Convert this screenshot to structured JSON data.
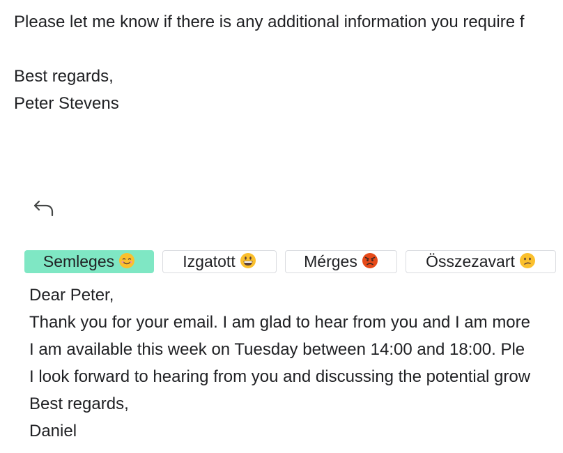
{
  "original_email": {
    "closing_line": "Please let me know if there is any additional information you require f",
    "signoff": "Best regards,",
    "sender_name": "Peter Stevens"
  },
  "reply_icon": "reply-arrow-icon",
  "tone_options": [
    {
      "label": "Semleges",
      "emoji": "smiling-face-icon",
      "selected": true
    },
    {
      "label": "Izgatott",
      "emoji": "grinning-face-icon",
      "selected": false
    },
    {
      "label": "Mérges",
      "emoji": "angry-face-icon",
      "selected": false
    },
    {
      "label": "Összezavart",
      "emoji": "confused-face-icon",
      "selected": false
    }
  ],
  "draft_reply": {
    "greeting": "Dear Peter,",
    "line1": "Thank you for your email. I am glad to hear from you and I am more",
    "line2": "I am available this week on Tuesday between 14:00 and 18:00. Ple",
    "line3": "I look forward to hearing from you and discussing the potential grow",
    "signoff": "Best regards,",
    "name": "Daniel"
  },
  "colors": {
    "selected_tone_bg": "#7fe7c4",
    "text": "#202124",
    "border": "#dadce0",
    "emoji_yellow": "#fbc02d",
    "emoji_red": "#e64a19"
  }
}
